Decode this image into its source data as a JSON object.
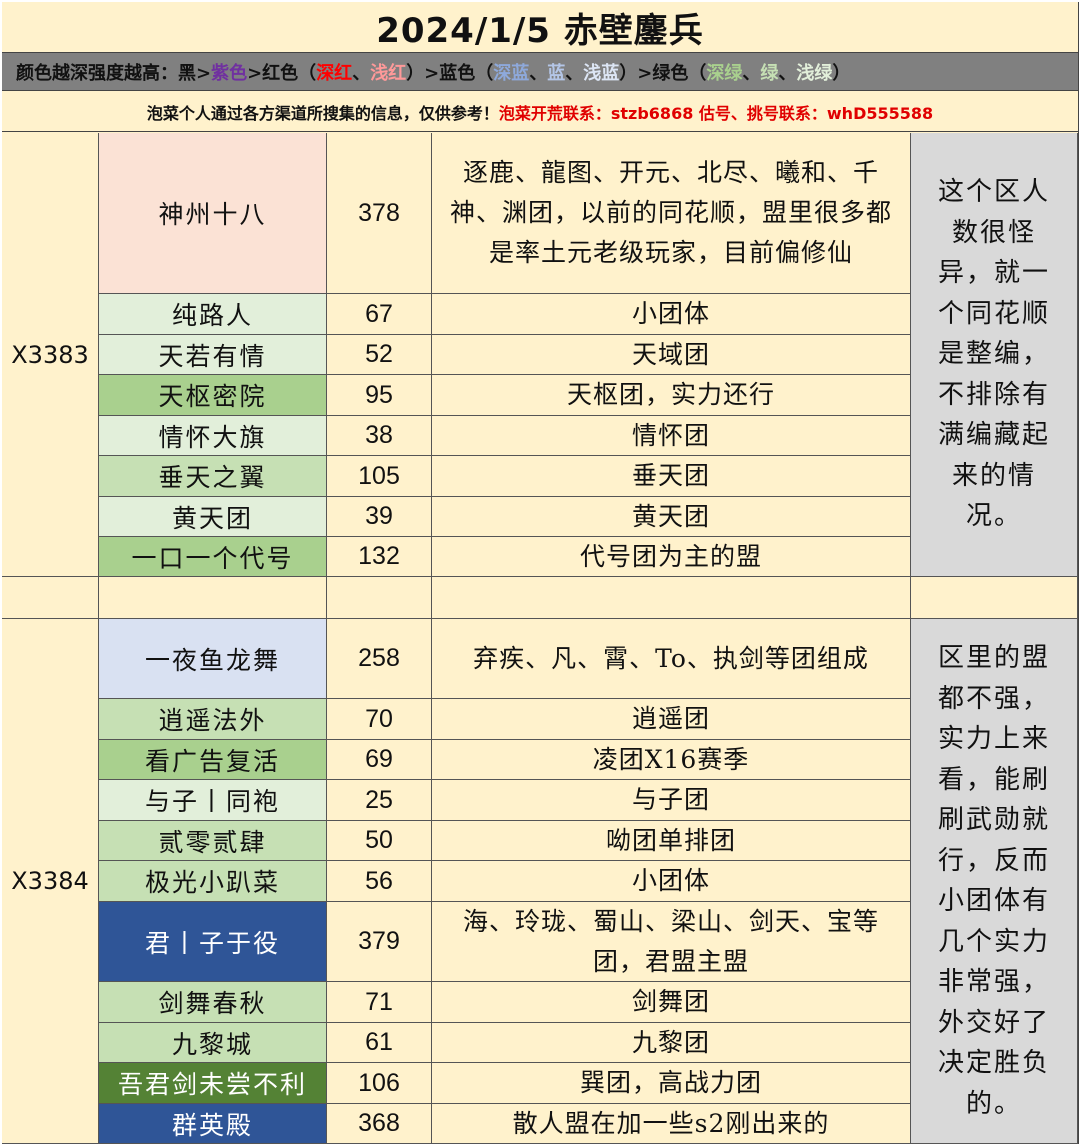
{
  "title": "2024/1/5  赤壁鏖兵",
  "legend": [
    {
      "text": "颜色越深强度越高：黑>",
      "color": "#111111"
    },
    {
      "text": "紫色",
      "color": "#7030a0"
    },
    {
      "text": ">红色（",
      "color": "#111111"
    },
    {
      "text": "深红",
      "color": "#ff0000"
    },
    {
      "text": "、",
      "color": "#111111"
    },
    {
      "text": "浅红",
      "color": "#ff9999"
    },
    {
      "text": "）>蓝色（",
      "color": "#111111"
    },
    {
      "text": "深蓝",
      "color": "#8ea9db"
    },
    {
      "text": "、",
      "color": "#111111"
    },
    {
      "text": "蓝",
      "color": "#b4c6e7"
    },
    {
      "text": "、",
      "color": "#111111"
    },
    {
      "text": "浅蓝",
      "color": "#dde6f5"
    },
    {
      "text": "）>绿色（",
      "color": "#111111"
    },
    {
      "text": "深绿",
      "color": "#a9d08e"
    },
    {
      "text": "、",
      "color": "#111111"
    },
    {
      "text": "绿",
      "color": "#c6e0b4"
    },
    {
      "text": "、",
      "color": "#111111"
    },
    {
      "text": "浅绿",
      "color": "#e2efda"
    },
    {
      "text": "）",
      "color": "#111111"
    }
  ],
  "note": {
    "main": "泡菜个人通过各方渠道所搜集的信息，仅供参考！",
    "contact": "泡菜开荒联系：stzb6868   估号、挑号联系：whD555588"
  },
  "servers": [
    {
      "server": "X3383",
      "remark": "这个区人数很怪异，就一个同花顺是整编，不排除有满编藏起来的情况。",
      "alliances": [
        {
          "name": "神州十八",
          "count": "378",
          "desc": "逐鹿、龍图、开元、北尽、曦和、千神、渊团，以前的同花顺，盟里很多都是率土元老级玩家，目前偏修仙",
          "color": "light-red"
        },
        {
          "name": "纯路人",
          "count": "67",
          "desc": "小团体",
          "color": "light-green"
        },
        {
          "name": "天若有情",
          "count": "52",
          "desc": "天域团",
          "color": "light-green"
        },
        {
          "name": "天枢密院",
          "count": "95",
          "desc": "天枢团，实力还行",
          "color": "deep-green"
        },
        {
          "name": "情怀大旗",
          "count": "38",
          "desc": "情怀团",
          "color": "light-green"
        },
        {
          "name": "垂天之翼",
          "count": "105",
          "desc": "垂天团",
          "color": "green"
        },
        {
          "name": "黄天团",
          "count": "39",
          "desc": "黄天团",
          "color": "light-green"
        },
        {
          "name": "一口一个代号",
          "count": "132",
          "desc": "代号团为主的盟",
          "color": "deep-green"
        }
      ]
    },
    {
      "server": "X3384",
      "remark": "区里的盟都不强，实力上来看，能刷刷武勋就行，反而小团体有几个实力非常强，外交好了决定胜负的。",
      "alliances": [
        {
          "name": "一夜鱼龙舞",
          "count": "258",
          "desc": "弃疾、凡、霄、To、执剑等团组成",
          "color": "light-blue"
        },
        {
          "name": "逍遥法外",
          "count": "70",
          "desc": "逍遥团",
          "color": "green"
        },
        {
          "name": "看广告复活",
          "count": "69",
          "desc": "凌团X16赛季",
          "color": "deep-green"
        },
        {
          "name": "与子丨同袍",
          "count": "25",
          "desc": "与子团",
          "color": "light-green"
        },
        {
          "name": "贰零贰肆",
          "count": "50",
          "desc": "呦团单排团",
          "color": "green"
        },
        {
          "name": "极光小趴菜",
          "count": "56",
          "desc": "小团体",
          "color": "green"
        },
        {
          "name": "君丨子于役",
          "count": "379",
          "desc": "海、玲珑、蜀山、梁山、剑天、宝等团，君盟主盟",
          "color": "deep-blue"
        },
        {
          "name": "剑舞春秋",
          "count": "71",
          "desc": "剑舞团",
          "color": "green"
        },
        {
          "name": "九黎城",
          "count": "61",
          "desc": "九黎团",
          "color": "green"
        },
        {
          "name": "吾君剑未尝不利",
          "count": "106",
          "desc": "巽团，高战力团",
          "color": "dark-green"
        },
        {
          "name": "群英殿",
          "count": "368",
          "desc": "散人盟在加一些s2刚出来的",
          "color": "deep-blue"
        }
      ]
    }
  ]
}
